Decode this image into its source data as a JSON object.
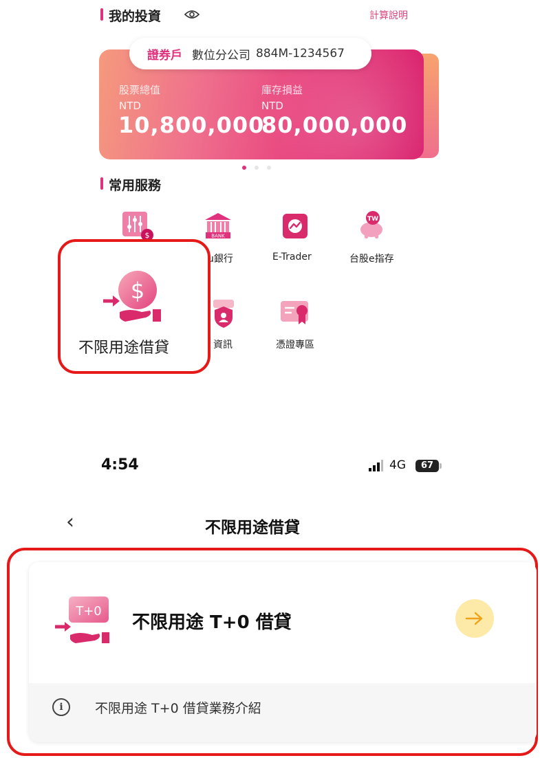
{
  "investment": {
    "section_title": "我的投資",
    "calc_link": "計算說明",
    "account": {
      "kind": "證券戶",
      "branch": "數位分公司",
      "number": "884M-1234567"
    },
    "stock_total": {
      "label": "股票總值",
      "currency": "NTD",
      "value": "10,800,000"
    },
    "inventory_pl": {
      "label": "庫存損益",
      "currency": "NTD",
      "value": "80,000,000"
    },
    "pager_count": 3,
    "pager_active": 0
  },
  "services": {
    "section_title": "常用服務",
    "items": [
      {
        "label": "",
        "icon": "sliders-dollar-icon"
      },
      {
        "label": "u銀行",
        "icon": "bank-icon"
      },
      {
        "label": "E-Trader",
        "icon": "e-trader-icon"
      },
      {
        "label": "台股e指存",
        "icon": "piggy-bank-icon",
        "badge": "TW"
      },
      {
        "label": "不限用途借貸",
        "icon": "hand-dollar-icon"
      },
      {
        "label": "資訊",
        "icon": "shield-user-icon"
      },
      {
        "label": "憑證專區",
        "icon": "certificate-icon"
      }
    ]
  },
  "status_bar": {
    "time": "4:54",
    "network": "4G",
    "battery": "67"
  },
  "nav": {
    "title": "不限用途借貸",
    "back": "‹"
  },
  "loan_card": {
    "icon_text": "T+0",
    "title": "不限用途 T+0 借貸",
    "intro": "不限用途 T+0 借貸業務介紹",
    "arrow": "→"
  },
  "colors": {
    "accent": "#e0317c",
    "highlight": "#e61919",
    "arrow_bg": "#fde9a8",
    "arrow": "#f0a21b"
  }
}
